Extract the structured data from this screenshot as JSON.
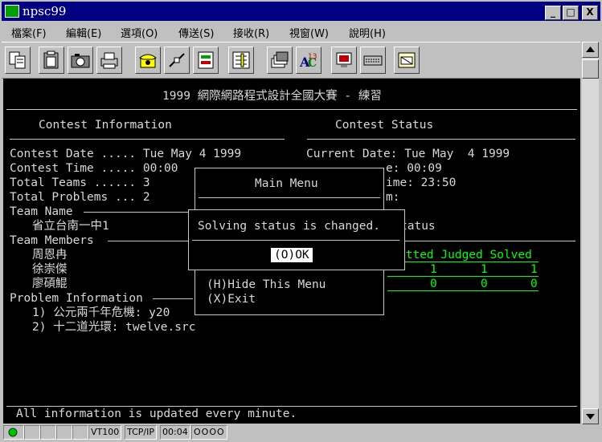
{
  "window": {
    "title": "npsc99",
    "minimize": "_",
    "maximize": "□",
    "close": "X"
  },
  "menu": [
    {
      "label": "檔案(F)"
    },
    {
      "label": "編輯(E)"
    },
    {
      "label": "選項(O)"
    },
    {
      "label": "傳送(S)"
    },
    {
      "label": "接收(R)"
    },
    {
      "label": "視窗(W)"
    },
    {
      "label": "說明(H)"
    }
  ],
  "toolbar": [
    "copy-icon",
    "paste-icon",
    "camera-icon",
    "print-icon",
    "phone-icon",
    "disconnect-icon",
    "transfer-icon",
    "settings-icon",
    "stack-icon",
    "spell-check-icon",
    "monitor-icon",
    "keyboard-icon",
    "screen-icon"
  ],
  "terminal": {
    "banner": "1999 網際網路程式設計全國大賽 - 練習",
    "contest_info_header": "Contest Information",
    "contest_status_header": "Contest Status",
    "contest_date": "Contest Date ..... Tue May 4 1999",
    "contest_time": "Contest Time ..... 00:00",
    "total_teams": "Total Teams ...... 3",
    "total_problems": "Total Problems ... 2",
    "team_name_label": "Team Name",
    "team_name": "省立台南一中1",
    "team_members_label": "Team Members",
    "members": [
      "周恩冉",
      "徐崇傑",
      "廖碩鯤"
    ],
    "problem_info_label": "Problem Information",
    "problems": [
      "1) 公元兩千年危機: y20",
      "2) 十二道光環: twelve.src"
    ],
    "current_date": "Current Date: Tue May  4 1999",
    "status_frag1": "e: 00:09",
    "status_frag2": "ime: 23:50",
    "status_frag3": "m:",
    "status_frag4": "tatus",
    "table_header": "itted Judged Solved",
    "table_rows": [
      {
        "submitted": "1",
        "judged": "1",
        "solved": "1"
      },
      {
        "submitted": "0",
        "judged": "0",
        "solved": "0"
      }
    ],
    "footer": "All information is updated every minute."
  },
  "main_menu": {
    "title": "Main Menu",
    "hide": "(H)Hide This Menu",
    "exit": "(X)Exit"
  },
  "alert": {
    "message": "Solving status is changed.",
    "ok": "(O)OK"
  },
  "statusbar": {
    "term": "VT100",
    "proto": "TCP/IP",
    "time": "00:04",
    "leds": "OOOO"
  }
}
